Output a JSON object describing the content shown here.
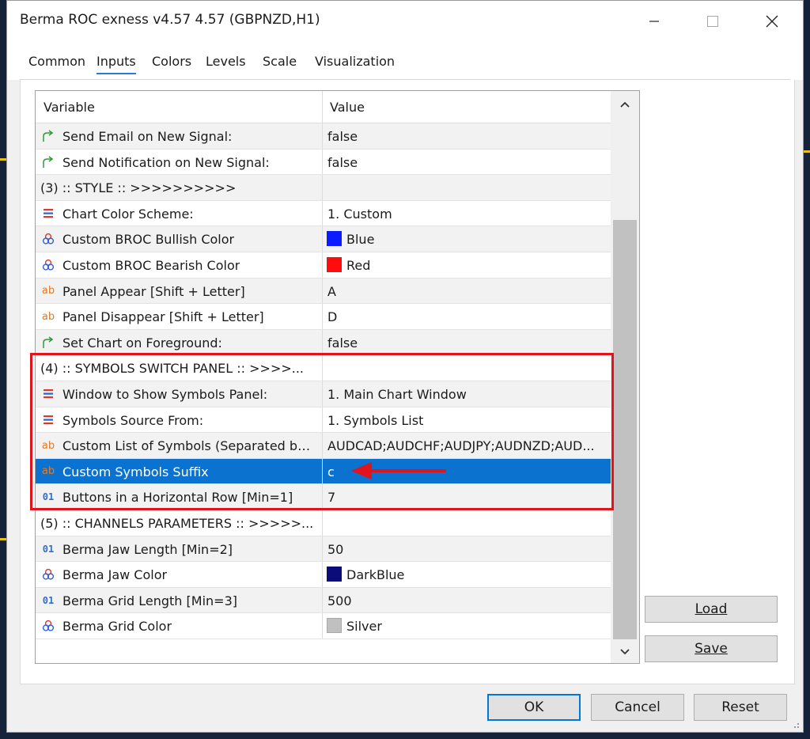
{
  "window": {
    "title": "Berma ROC exness v4.57 4.57 (GBPNZD,H1)",
    "controls": [
      "minimize",
      "maximize",
      "close"
    ]
  },
  "tabs": [
    {
      "label": "Common",
      "active": false
    },
    {
      "label": "Inputs",
      "active": true
    },
    {
      "label": "Colors",
      "active": false
    },
    {
      "label": "Levels",
      "active": false
    },
    {
      "label": "Scale",
      "active": false
    },
    {
      "label": "Visualization",
      "active": false
    }
  ],
  "grid": {
    "columns": {
      "variable": "Variable",
      "value": "Value"
    },
    "rows": [
      {
        "icon": "arrow-icon",
        "variable": "Send Email on New Signal:",
        "value": "false"
      },
      {
        "icon": "arrow-icon",
        "variable": "Send Notification on New Signal:",
        "value": "false"
      },
      {
        "icon": "none",
        "section": true,
        "variable": "(3) :: STYLE :: >>>>>>>>>>",
        "value": ""
      },
      {
        "icon": "enum-icon",
        "variable": "Chart Color Scheme:",
        "value": "1. Custom"
      },
      {
        "icon": "color-icon",
        "variable": "Custom BROC Bullish Color",
        "value": "Blue",
        "swatch": "#0a1cff"
      },
      {
        "icon": "color-icon",
        "variable": "Custom BROC Bearish Color",
        "value": "Red",
        "swatch": "#ff0d0d"
      },
      {
        "icon": "string-icon",
        "variable": "Panel Appear [Shift + Letter]",
        "value": "A"
      },
      {
        "icon": "string-icon",
        "variable": "Panel Disappear [Shift + Letter]",
        "value": "D"
      },
      {
        "icon": "arrow-icon",
        "variable": "Set Chart on Foreground:",
        "value": "false"
      },
      {
        "icon": "none",
        "section": true,
        "variable": "(4) :: SYMBOLS SWITCH PANEL :: >>>>...",
        "value": ""
      },
      {
        "icon": "enum-icon",
        "variable": "Window to Show Symbols Panel:",
        "value": "1. Main Chart Window"
      },
      {
        "icon": "enum-icon",
        "variable": "Symbols Source From:",
        "value": "1. Symbols List"
      },
      {
        "icon": "string-icon",
        "variable": "Custom List of Symbols (Separated by ...",
        "value": "AUDCAD;AUDCHF;AUDJPY;AUDNZD;AUD..."
      },
      {
        "icon": "string-icon",
        "variable": "Custom Symbols Suffix",
        "value": "c",
        "selected": true
      },
      {
        "icon": "int-icon",
        "variable": "Buttons in a Horizontal Row [Min=1]",
        "value": "7"
      },
      {
        "icon": "none",
        "section": true,
        "variable": "(5) :: CHANNELS PARAMETERS :: >>>>>...",
        "value": ""
      },
      {
        "icon": "int-icon",
        "variable": "Berma Jaw Length [Min=2]",
        "value": "50"
      },
      {
        "icon": "color-icon",
        "variable": "Berma Jaw Color",
        "value": "DarkBlue",
        "swatch": "#0b0b7a"
      },
      {
        "icon": "int-icon",
        "variable": "Berma Grid Length [Min=3]",
        "value": "500"
      },
      {
        "icon": "color-icon",
        "variable": "Berma Grid Color",
        "value": "Silver",
        "swatch": "#c0c0c0"
      }
    ]
  },
  "buttons": {
    "load": "Load",
    "save": "Save",
    "ok": "OK",
    "cancel": "Cancel",
    "reset": "Reset"
  },
  "colors": {
    "selection": "#0b72d0",
    "highlight_box": "#e0141a",
    "accent": "#0078d7"
  }
}
